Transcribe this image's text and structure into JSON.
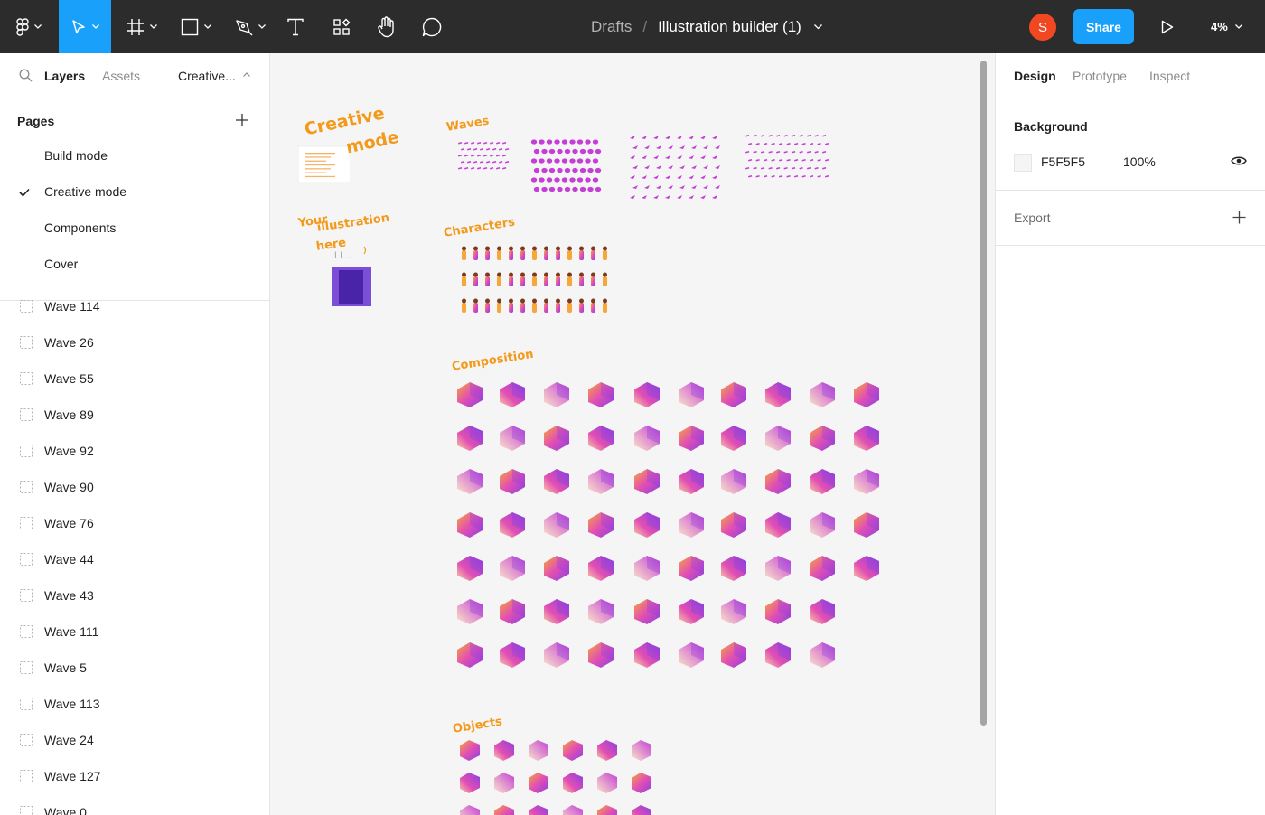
{
  "toolbar": {
    "file_path": {
      "project": "Drafts",
      "separator": "/",
      "file_name": "Illustration builder (1)"
    },
    "tools": [
      {
        "name": "main-menu",
        "icon": "figma-logo-icon"
      },
      {
        "name": "move-tool",
        "icon": "cursor-arrow-icon",
        "active": true
      },
      {
        "name": "frame-tool",
        "icon": "frame-hash-icon"
      },
      {
        "name": "shape-tool",
        "icon": "rectangle-icon"
      },
      {
        "name": "pen-tool",
        "icon": "pen-nib-icon"
      },
      {
        "name": "text-tool",
        "icon": "text-t-icon"
      },
      {
        "name": "components-tool",
        "icon": "components-grid-icon"
      },
      {
        "name": "hand-tool",
        "icon": "hand-icon"
      },
      {
        "name": "comment-tool",
        "icon": "comment-bubble-icon"
      }
    ],
    "avatar_initial": "S",
    "share_label": "Share",
    "zoom_label": "4%",
    "colors": {
      "bar": "#2c2c2c",
      "accent": "#18a0fb",
      "avatar": "#f24822"
    }
  },
  "left_panel": {
    "tabs": {
      "layers": "Layers",
      "assets": "Assets",
      "current_page": "Creative..."
    },
    "pages_heading": "Pages",
    "pages": [
      {
        "label": "Build mode",
        "selected": false
      },
      {
        "label": "Creative mode",
        "selected": true
      },
      {
        "label": "Components",
        "selected": false
      },
      {
        "label": "Cover",
        "selected": false
      }
    ],
    "layers": [
      "Wave 114",
      "Wave 26",
      "Wave 55",
      "Wave 89",
      "Wave 92",
      "Wave 90",
      "Wave 76",
      "Wave 44",
      "Wave 43",
      "Wave 111",
      "Wave 5",
      "Wave 113",
      "Wave 24",
      "Wave 127",
      "Wave 0"
    ]
  },
  "canvas": {
    "background": "#f5f5f5",
    "labels": {
      "creative": "Creative",
      "mode": "mode",
      "your": "Your",
      "illustration": "illustration",
      "here": "here",
      "ill_hint": "ILL...",
      "waves": "Waves",
      "characters": "Characters",
      "composition": "Composition",
      "objects": "Objects"
    },
    "colors": {
      "heading": "#f39a1b",
      "placeholder_frame": "#7b4ed8",
      "art_primary": "#c33fd6",
      "art_secondary": "#f7a63a"
    }
  },
  "right_panel": {
    "tabs": {
      "design": "Design",
      "prototype": "Prototype",
      "inspect": "Inspect"
    },
    "background": {
      "title": "Background",
      "hex": "F5F5F5",
      "opacity": "100%"
    },
    "export": {
      "title": "Export"
    }
  }
}
